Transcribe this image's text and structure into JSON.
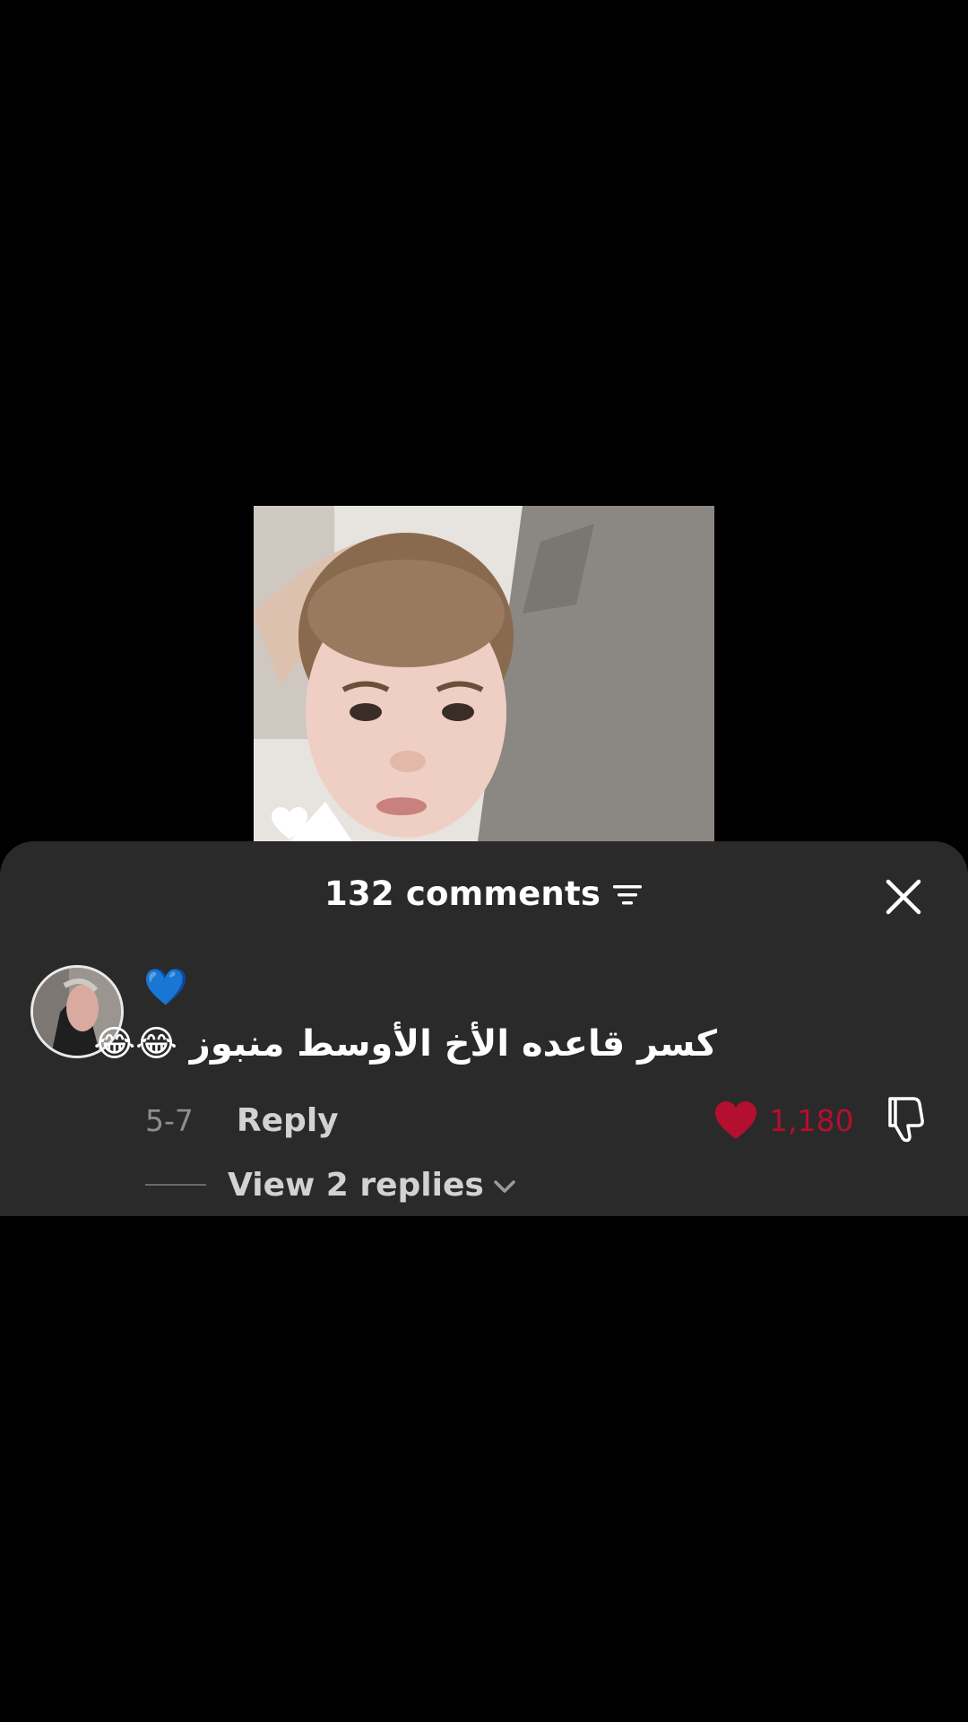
{
  "video": {
    "liked_icon": "heart-outline-icon"
  },
  "comments_header": {
    "title": "132 comments",
    "sort_icon": "sort-icon",
    "close_icon": "close-icon"
  },
  "comment": {
    "avatar_icon": "avatar",
    "emoji_line": "💙",
    "text": "كسر قاعده الأخ الأوسط منبوز 😂😂",
    "date": "5-7",
    "reply_label": "Reply",
    "like_count": "1,180",
    "liked": true,
    "like_color": "#b30f2e",
    "view_replies_label": "View 2 replies"
  },
  "colors": {
    "sheet_background": "#2a2a2a",
    "page_background": "#000000"
  }
}
